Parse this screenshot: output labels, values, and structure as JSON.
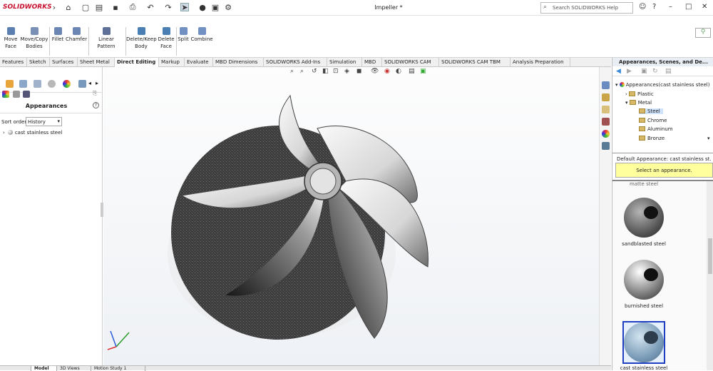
{
  "app": {
    "logo": "SOLIDWORKS",
    "doc_title": "Impeller *",
    "help_placeholder": "Search SOLIDWORKS Help"
  },
  "ribbon": {
    "commands": [
      {
        "id": "move-face",
        "label": "Move\nFace"
      },
      {
        "id": "move-copy-bodies",
        "label": "Move/Copy\nBodies"
      },
      {
        "id": "fillet",
        "label": "Fillet"
      },
      {
        "id": "chamfer",
        "label": "Chamfer"
      },
      {
        "id": "linear-pattern",
        "label": "Linear Pattern"
      },
      {
        "id": "delete-keep-body",
        "label": "Delete/Keep\nBody"
      },
      {
        "id": "delete-face",
        "label": "Delete\nFace"
      },
      {
        "id": "split",
        "label": "Split"
      },
      {
        "id": "combine",
        "label": "Combine"
      }
    ]
  },
  "tabs": [
    "Features",
    "Sketch",
    "Surfaces",
    "Sheet Metal",
    "Direct Editing",
    "Markup",
    "Evaluate",
    "MBD Dimensions",
    "SOLIDWORKS Add-Ins",
    "Simulation",
    "MBD",
    "SOLIDWORKS CAM",
    "SOLIDWORKS CAM TBM",
    "Analysis Preparation"
  ],
  "active_tab": "Direct Editing",
  "left_panel": {
    "title": "Appearances",
    "sort_label": "Sort order:",
    "sort_value": "History",
    "item": "cast stainless steel"
  },
  "bottom_tabs": [
    "",
    "Model",
    "3D Views",
    "Motion Study 1"
  ],
  "right_panel": {
    "header": "Appearances, Scenes, and De...",
    "tree": {
      "root": "Appearances(cast stainless steel)",
      "plastic": "Plastic",
      "metal": "Metal",
      "children": [
        "Steel",
        "Chrome",
        "Aluminum",
        "Bronze"
      ]
    },
    "default_appearance": "Default Appearance: cast stainless st...",
    "hint": "Select an appearance.",
    "gallery_top": "matte steel",
    "gallery": [
      "sandblasted steel",
      "burnished steel",
      "cast stainless steel"
    ]
  },
  "colors": {
    "accent": "#1f6fd1",
    "hint_bg": "#ffff9e",
    "logo": "#c8102e"
  }
}
